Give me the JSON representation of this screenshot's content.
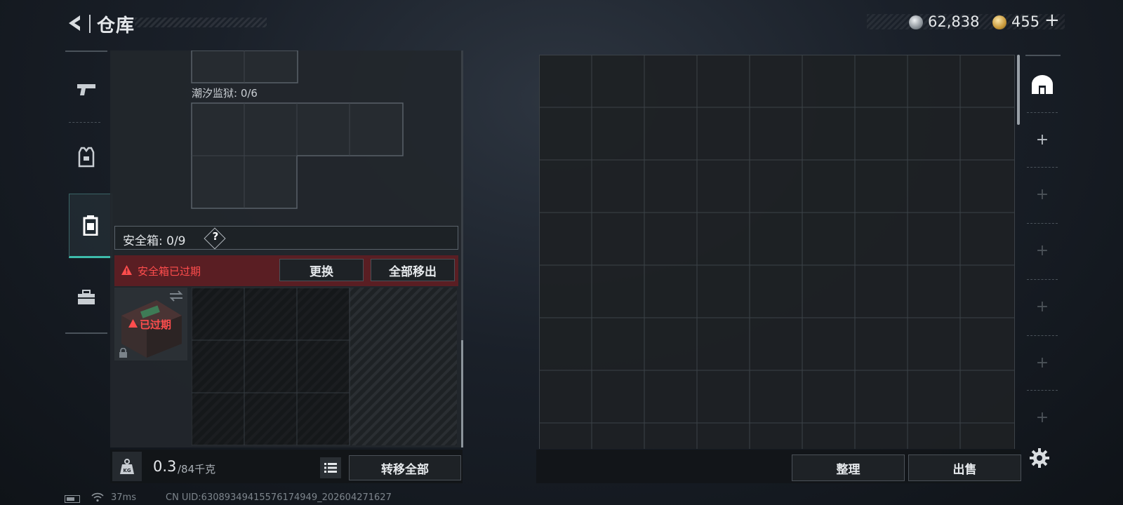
{
  "header": {
    "title": "仓库",
    "currency": {
      "silver_value": "62,838",
      "gold_value": "455",
      "gold_add_symbol": "+"
    }
  },
  "left_tabs": [
    {
      "name": "weapon",
      "icon": "pistol-icon",
      "active": false
    },
    {
      "name": "gear",
      "icon": "armor-vest-icon",
      "active": false
    },
    {
      "name": "container",
      "icon": "container-box-icon",
      "active": true
    },
    {
      "name": "tools",
      "icon": "toolbox-icon",
      "active": false
    }
  ],
  "inventory": {
    "tide_prison_label": "潮汐监狱: 0/6",
    "safe_box_label": "安全箱: 0/9",
    "help_symbol": "?",
    "expired_warning": "安全箱已过期",
    "replace_button": "更换",
    "move_all_out_button": "全部移出",
    "safe_item_status": "已过期",
    "weight_current": "0.3",
    "weight_max": "/84千克",
    "transfer_all_button": "转移全部"
  },
  "stash": {
    "organize_button": "整理",
    "sell_button": "出售"
  },
  "right_rail": {
    "active_icon": "stash-home-icon",
    "slots": [
      "+",
      "+",
      "+",
      "+",
      "+",
      "+"
    ]
  },
  "status_bar": {
    "ping": "37ms",
    "uid": "CN UID:630893494155761749​49_202604271627"
  },
  "colors": {
    "accent_teal": "#3dbcab",
    "warning_red": "#ff4d4d",
    "warning_bg": "#5a1e23"
  }
}
